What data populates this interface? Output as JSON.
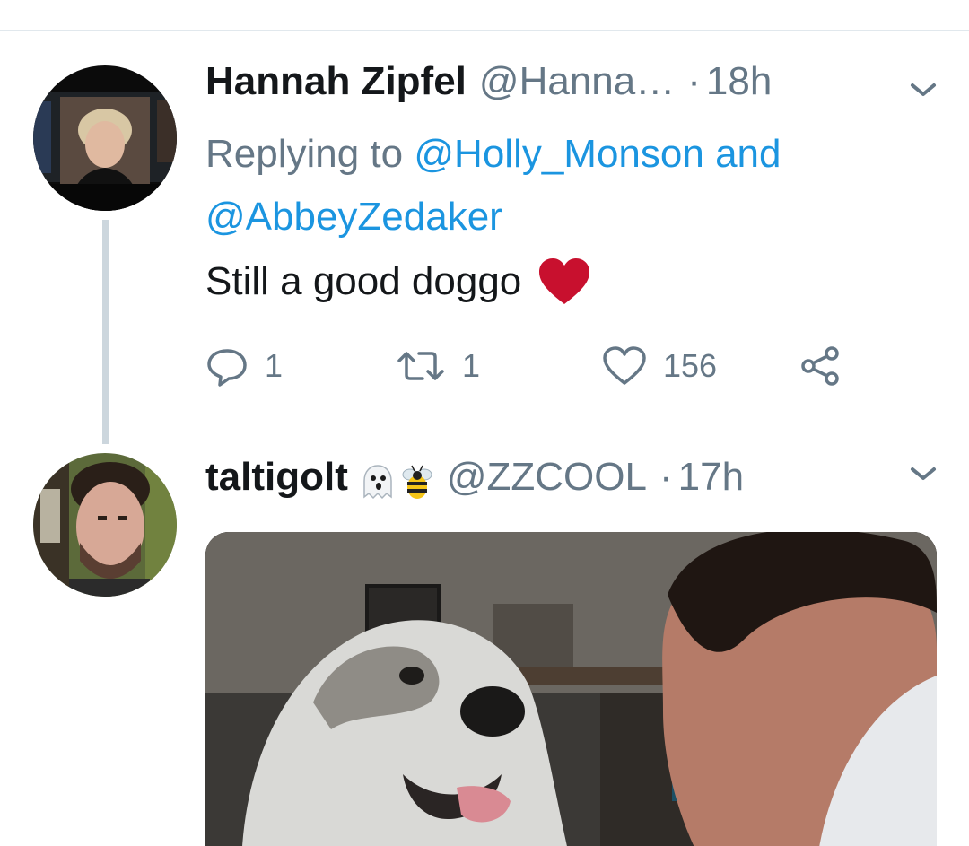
{
  "tweets": [
    {
      "display_name": "Hannah Zipfel",
      "handle": "@Hanna…",
      "separator": "·",
      "time": "18h",
      "replying_prefix": "Replying to",
      "replying_to_1": "@Holly_Monson",
      "replying_join": "and",
      "replying_to_2": "@AbbeyZedaker",
      "text": "Still a good doggo",
      "text_emoji": "red-heart",
      "reply_count": "1",
      "retweet_count": "1",
      "like_count": "156"
    },
    {
      "display_name": "taltigolt",
      "name_emojis": [
        "ghost",
        "bee"
      ],
      "handle": "@ZZCOOL",
      "separator": "·",
      "time": "17h",
      "media": "gif-dog-and-man"
    }
  ],
  "colors": {
    "text": "#14171a",
    "muted": "#657786",
    "link": "#1b95e0",
    "thread_line": "#ccd6dd",
    "divider": "#e1e8ed",
    "heart": "#c8102e"
  },
  "icons": [
    "reply-icon",
    "retweet-icon",
    "like-icon",
    "share-icon",
    "chevron-down-icon"
  ]
}
